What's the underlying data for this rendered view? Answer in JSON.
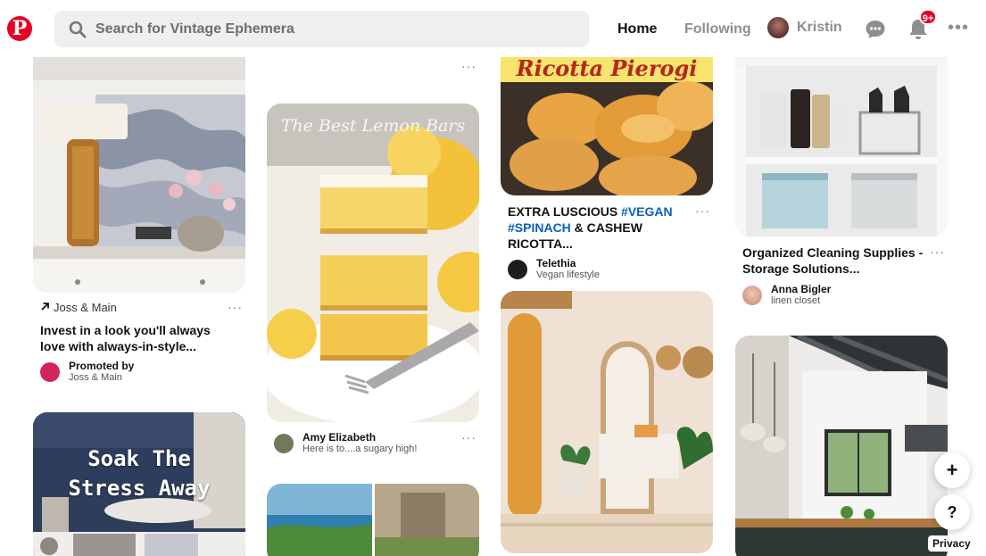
{
  "header": {
    "search_placeholder": "Search for Vintage Ephemera",
    "nav_home": "Home",
    "nav_following": "Following",
    "user_name": "Kristin",
    "notification_badge": "9+"
  },
  "brand_color": "#e60023",
  "pins": [
    {
      "id": "pin1",
      "source": "Joss & Main",
      "title": "Invest in a look you'll always love with always-in-style...",
      "promoted_label": "Promoted by",
      "promoter": "Joss & Main",
      "more": "···"
    },
    {
      "id": "pin2",
      "image_text": "The Best Lemon Bars",
      "user": "Amy Elizabeth",
      "note": "Here is to....a sugary high!",
      "more": "···"
    },
    {
      "id": "pin3",
      "image_text": "Ricotta Pierogi",
      "title_plain_1": "EXTRA LUSCIOUS ",
      "title_tag_1": "#VEGAN",
      "title_tag_2": "#SPINACH",
      "title_plain_2": " & CASHEW",
      "title_plain_3": "RICOTTA...",
      "user": "Telethia",
      "board": "Vegan lifestyle",
      "more": "···"
    },
    {
      "id": "pin4",
      "title": "Organized Cleaning Supplies - Storage Solutions...",
      "user": "Anna Bigler",
      "board": "linen closet",
      "more": "···"
    },
    {
      "id": "pin5",
      "image_text_1": "Soak The",
      "image_text_2": "Stress Away"
    },
    {
      "id": "pin_top2",
      "more": "···"
    }
  ],
  "floating": {
    "add": "+",
    "help": "?",
    "privacy": "Privacy"
  }
}
